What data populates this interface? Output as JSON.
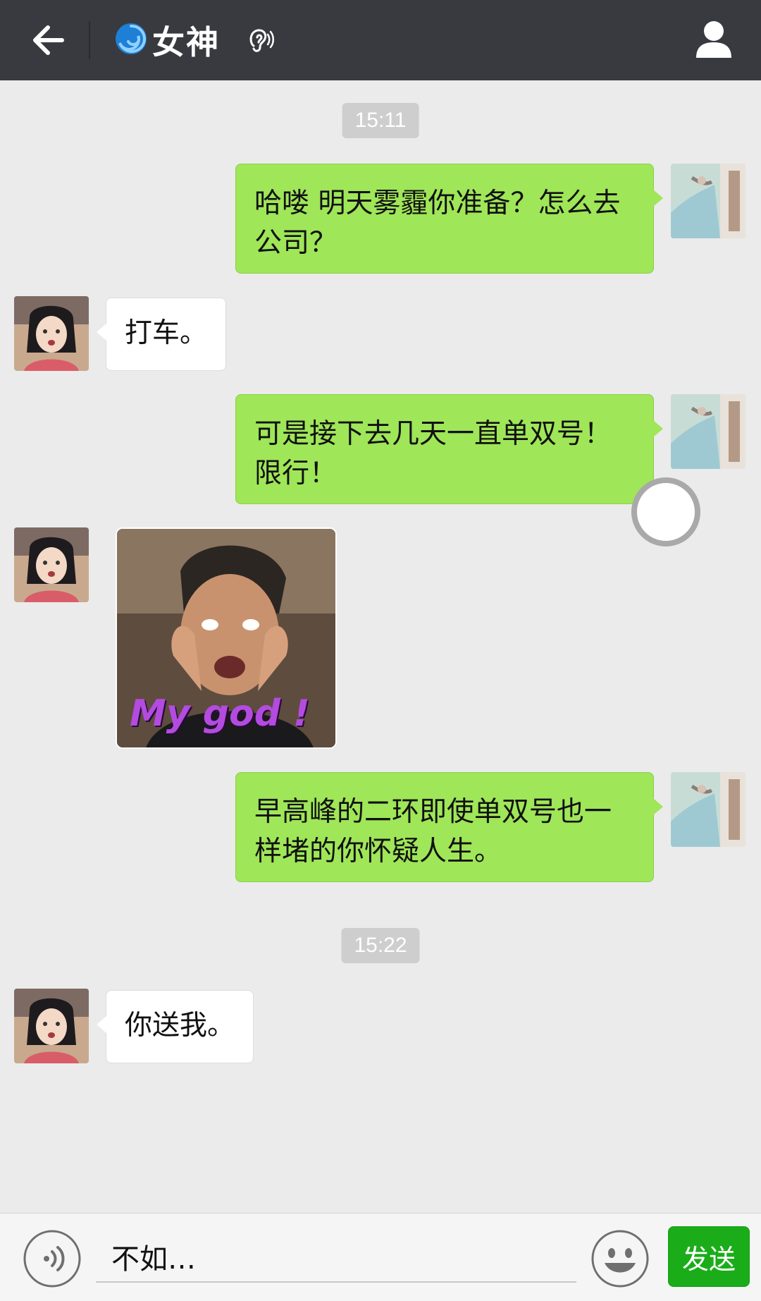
{
  "header": {
    "title_emoji": "🌀",
    "title": "女神",
    "back_icon": "back-arrow-icon",
    "ear_icon": "earpiece-mode-icon",
    "profile_icon": "user-profile-icon"
  },
  "messages": {
    "time1": "15:11",
    "m1": "哈喽 明天雾霾你准备？怎么去公司？",
    "m2": "打车。",
    "m3": "可是接下去几天一直单双号！限行！",
    "sticker_text": "My god !",
    "m4": "早高峰的二环即使单双号也一样堵的你怀疑人生。",
    "time2": "15:22",
    "m5": "你送我。"
  },
  "input": {
    "value": "不如…",
    "send_label": "发送"
  },
  "colors": {
    "header_bg": "#393a3f",
    "my_bubble": "#9fe658",
    "their_bubble": "#ffffff",
    "send_button": "#1aad19",
    "background": "#ebebeb"
  }
}
